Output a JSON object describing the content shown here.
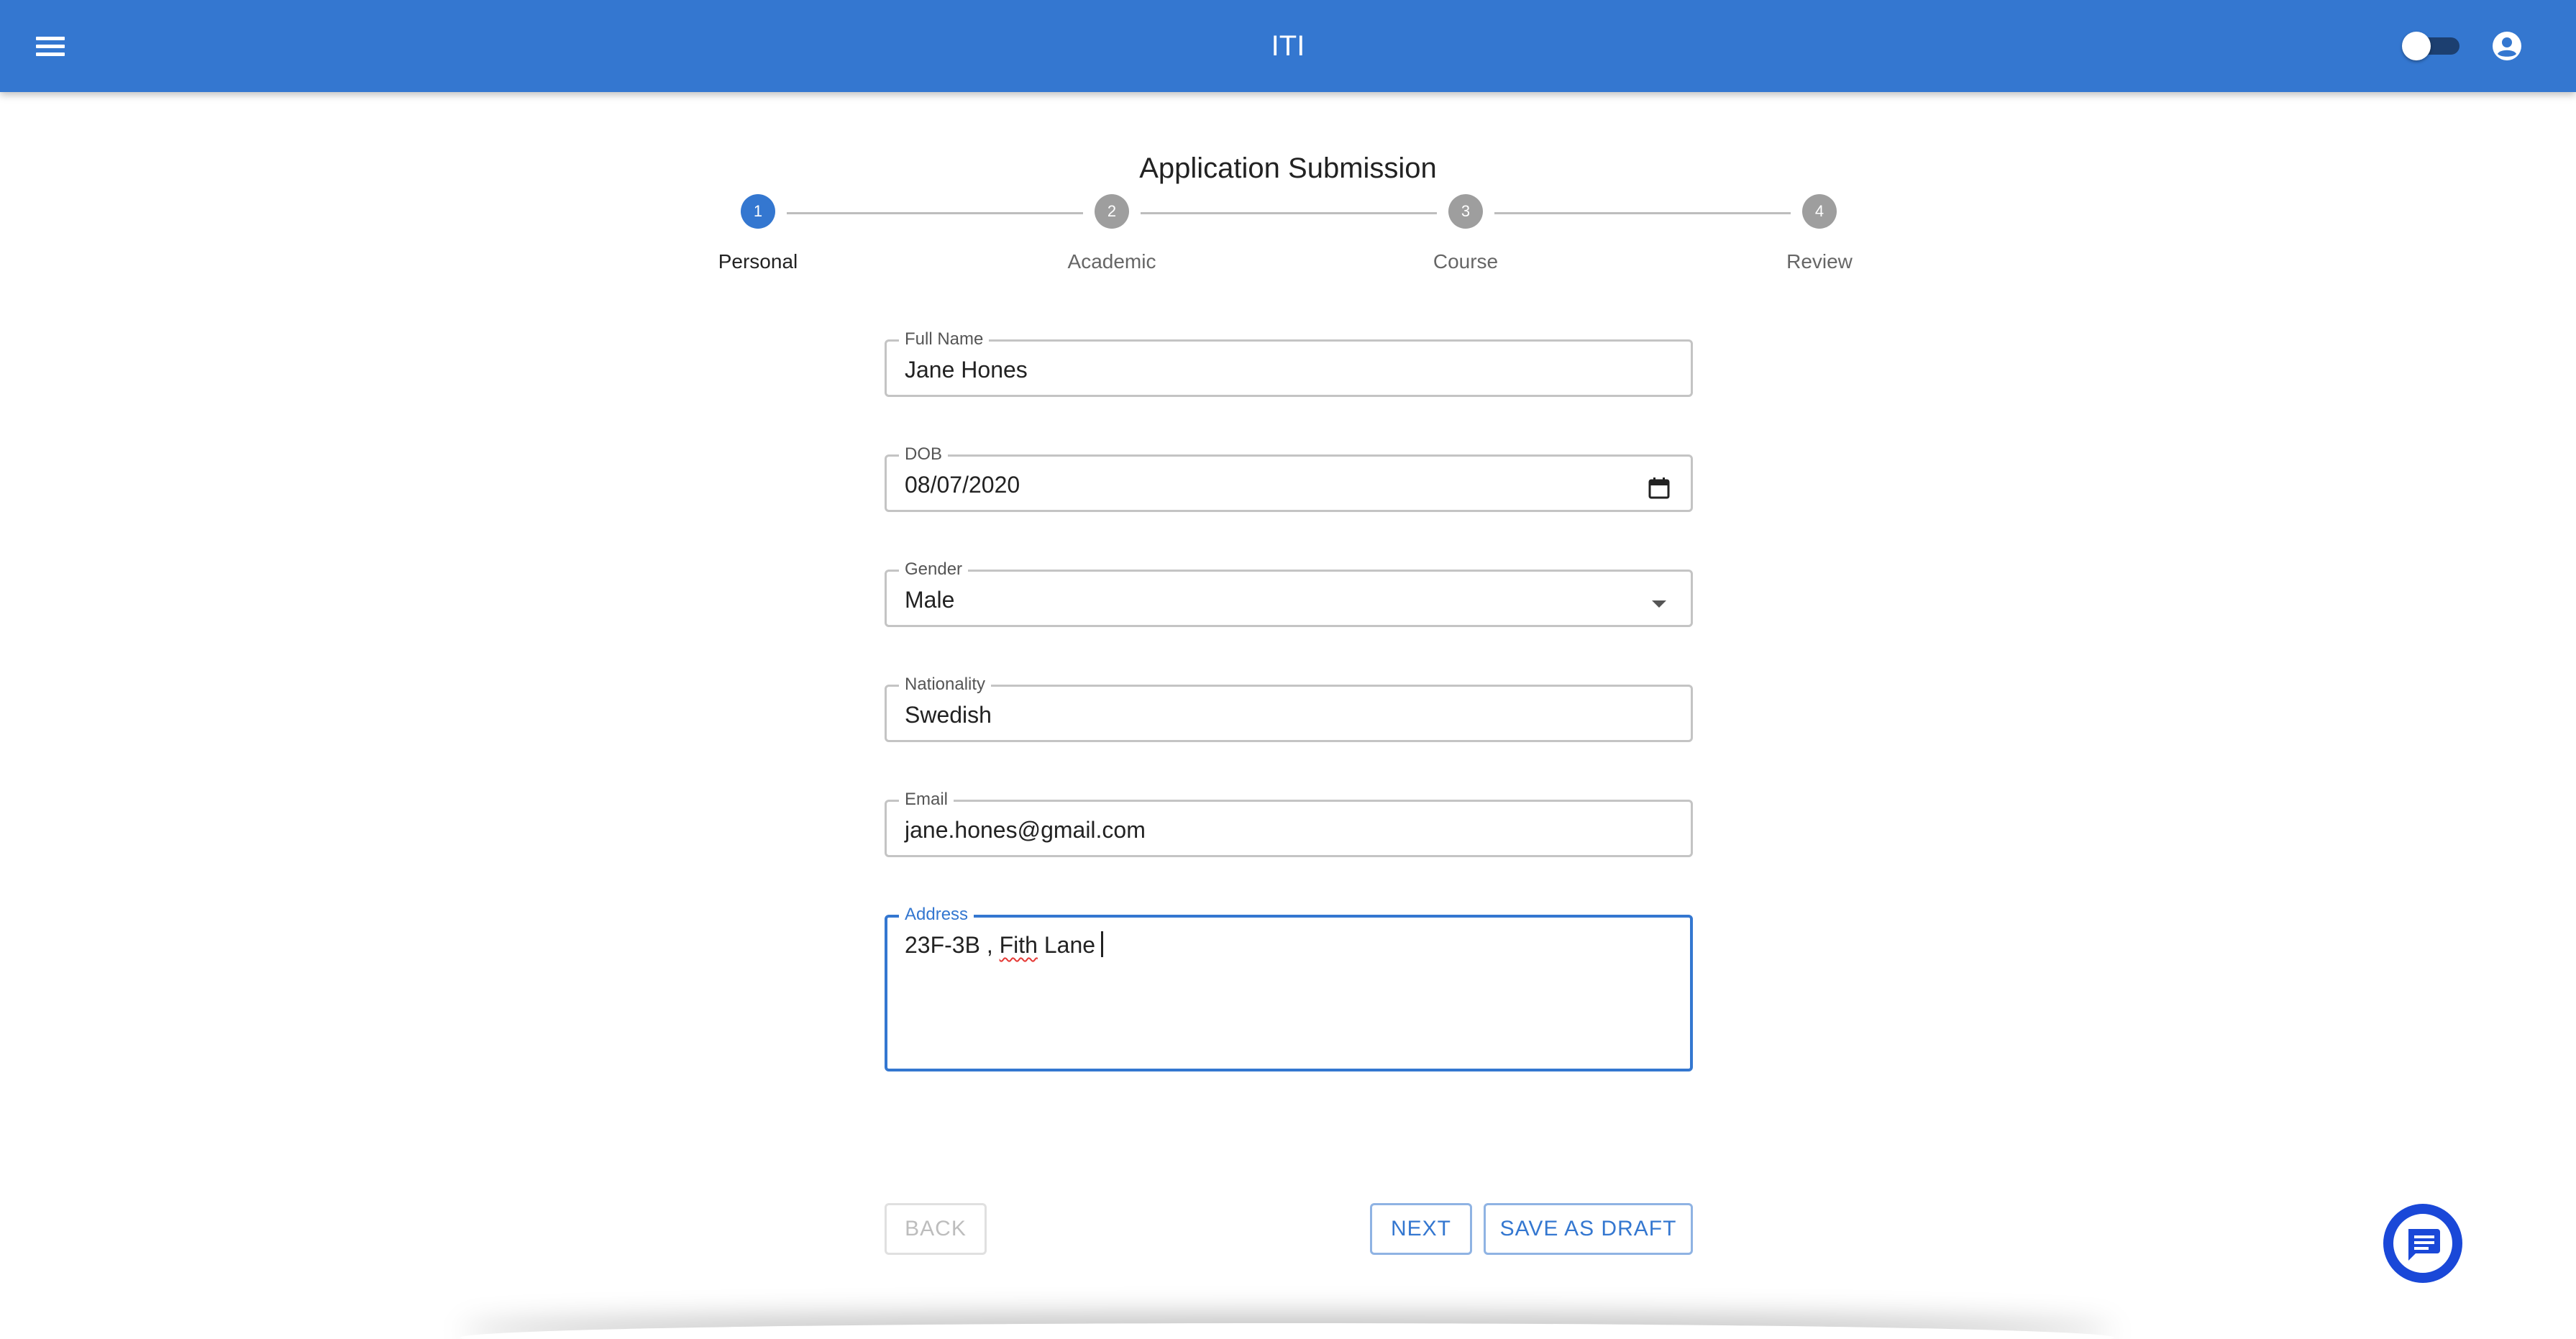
{
  "app": {
    "title": "ITI",
    "accent_color": "#3477d0"
  },
  "header": {
    "menu_icon": "menu-icon",
    "theme_toggle_icon": "toggle-switch",
    "account_icon": "account-circle-icon"
  },
  "page": {
    "title": "Application Submission"
  },
  "stepper": {
    "active_step": 1,
    "steps": [
      {
        "number": "1",
        "label": "Personal"
      },
      {
        "number": "2",
        "label": "Academic"
      },
      {
        "number": "3",
        "label": "Course"
      },
      {
        "number": "4",
        "label": "Review"
      }
    ]
  },
  "form": {
    "full_name": {
      "label": "Full Name",
      "value": "Jane Hones"
    },
    "dob": {
      "label": "DOB",
      "value": "08/07/2020",
      "icon": "calendar-icon"
    },
    "gender": {
      "label": "Gender",
      "value": "Male",
      "icon": "dropdown-arrow-icon"
    },
    "nationality": {
      "label": "Nationality",
      "value": "Swedish"
    },
    "email": {
      "label": "Email",
      "value": "jane.hones@gmail.com"
    },
    "address": {
      "label": "Address",
      "value_prefix": "23F-3B , ",
      "value_misspelled": "Fith",
      "value_suffix": " Lane"
    }
  },
  "actions": {
    "back_label": "BACK",
    "next_label": "NEXT",
    "save_draft_label": "SAVE AS DRAFT"
  },
  "chat": {
    "icon": "chat-icon",
    "color": "#1a48d8"
  }
}
